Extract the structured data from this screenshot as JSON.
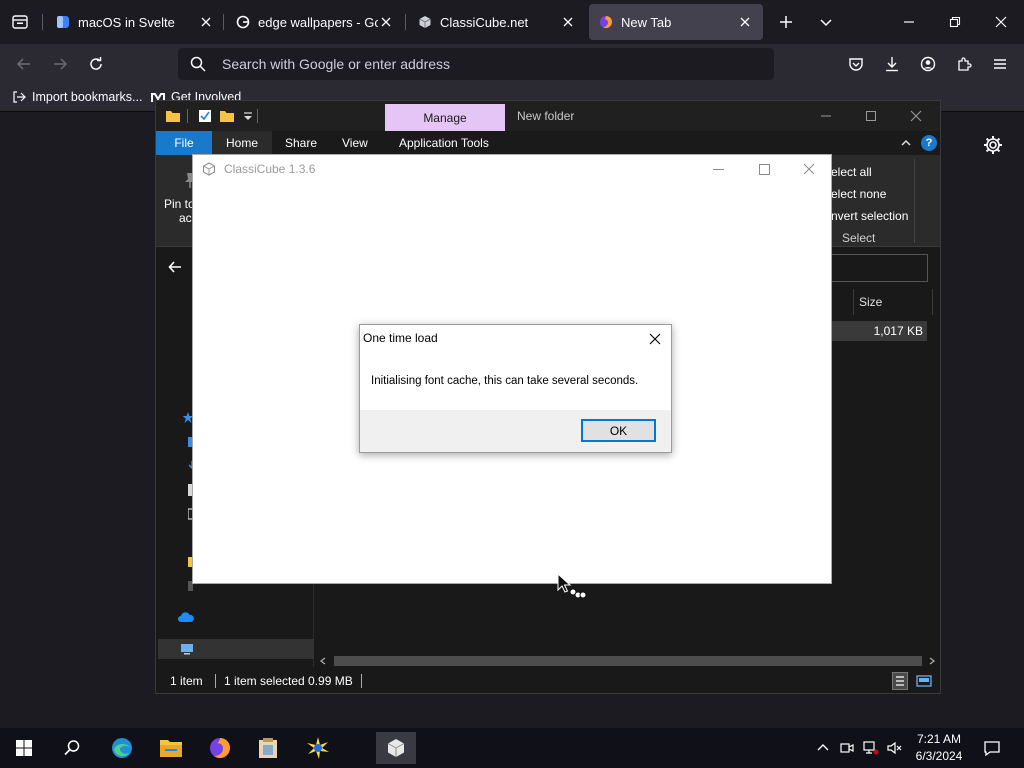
{
  "browser": {
    "tabs": [
      {
        "title": "macOS in Svelte",
        "active": false
      },
      {
        "title": "edge wallpapers - Goo",
        "active": false
      },
      {
        "title": "ClassiCube.net",
        "active": false
      },
      {
        "title": "New Tab",
        "active": true
      }
    ],
    "url_placeholder": "Search with Google or enter address",
    "bookmarks": [
      {
        "label": "Import bookmarks..."
      },
      {
        "label": "Get Involved"
      }
    ]
  },
  "explorer": {
    "folder_title": "New folder",
    "manage_tab": "Manage",
    "ribbon_tabs": [
      "File",
      "Home",
      "Share",
      "View",
      "Application Tools"
    ],
    "ribbon_left_1": "Pin to",
    "ribbon_left_2": "ac",
    "select_items": [
      "elect all",
      "elect none",
      "nvert selection"
    ],
    "select_group": "Select",
    "column_size": "Size",
    "row_size": "1,017 KB",
    "status_items": "1 item",
    "status_selected": "1 item selected  0.99 MB"
  },
  "classicube": {
    "title": "ClassiCube 1.3.6"
  },
  "dialog": {
    "title": "One time load",
    "message": "Initialising font cache, this can take several seconds.",
    "ok_label": "OK"
  },
  "taskbar": {
    "time": "7:21 AM",
    "date": "6/3/2024"
  },
  "colors": {
    "browser_bg": "#1c1b22",
    "toolbar_bg": "#2b2a33",
    "manage_accent": "#e5c5f6",
    "file_tab_blue": "#1979ca",
    "ok_border": "#0078d7"
  }
}
